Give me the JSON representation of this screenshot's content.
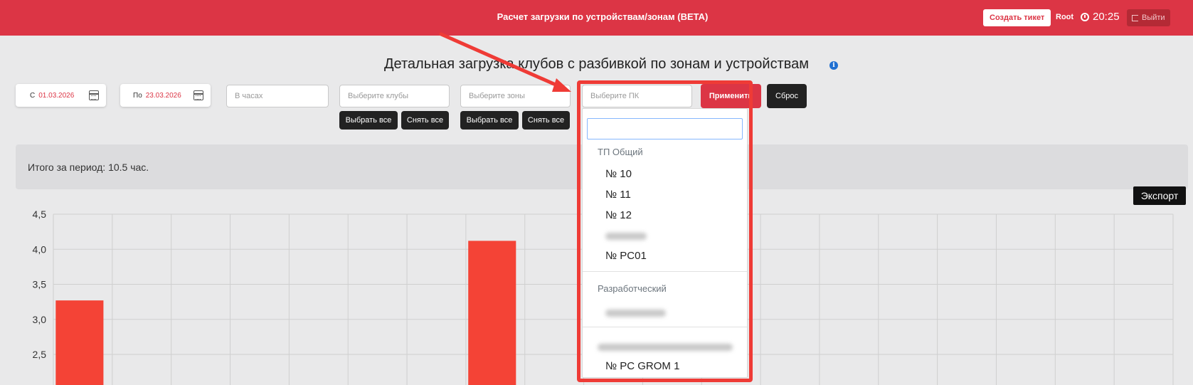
{
  "topbar": {
    "title": "Расчет загрузки по устройствам/зонам (BETA)",
    "create_ticket": "Создать тикет",
    "user": "Root",
    "time": "20:25",
    "logout": "Выйти"
  },
  "page": {
    "heading": "Детальная загрузка клубов с разбивкой по зонам и устройствам"
  },
  "filters": {
    "date_from_prefix": "С",
    "date_from": "01.03.2026",
    "date_to_prefix": "По",
    "date_to": "23.03.2026",
    "hours_placeholder": "В часах",
    "clubs_placeholder": "Выберите клубы",
    "zones_placeholder": "Выберите зоны",
    "pc_placeholder": "Выберите ПК",
    "select_all": "Выбрать все",
    "deselect_all": "Снять все",
    "apply": "Применить",
    "reset": "Сброс"
  },
  "summary": {
    "total": "Итого за период: 10.5 час."
  },
  "export_label": "Экспорт",
  "dropdown": {
    "groups": [
      {
        "label": "ТП Общий",
        "items": [
          "№ 10",
          "№ 11",
          "№ 12",
          "",
          "№ PC01"
        ]
      },
      {
        "label": "Разработческий",
        "items": [
          ""
        ]
      },
      {
        "label": "",
        "items": [
          "№ PC GROM 1"
        ]
      }
    ]
  },
  "chart_data": {
    "type": "bar",
    "yticks": [
      "4,5",
      "4,0",
      "3,5",
      "3,0",
      "2,5"
    ],
    "ylim": [
      2.1,
      4.5
    ],
    "num_columns": 19,
    "bars": [
      {
        "column": 0,
        "value": 3.27
      },
      {
        "column": 7,
        "value": 4.12
      }
    ],
    "bar_color": "#f44336",
    "grid": true
  },
  "colors": {
    "accent": "#dc3545",
    "highlight": "#ef3b36"
  }
}
